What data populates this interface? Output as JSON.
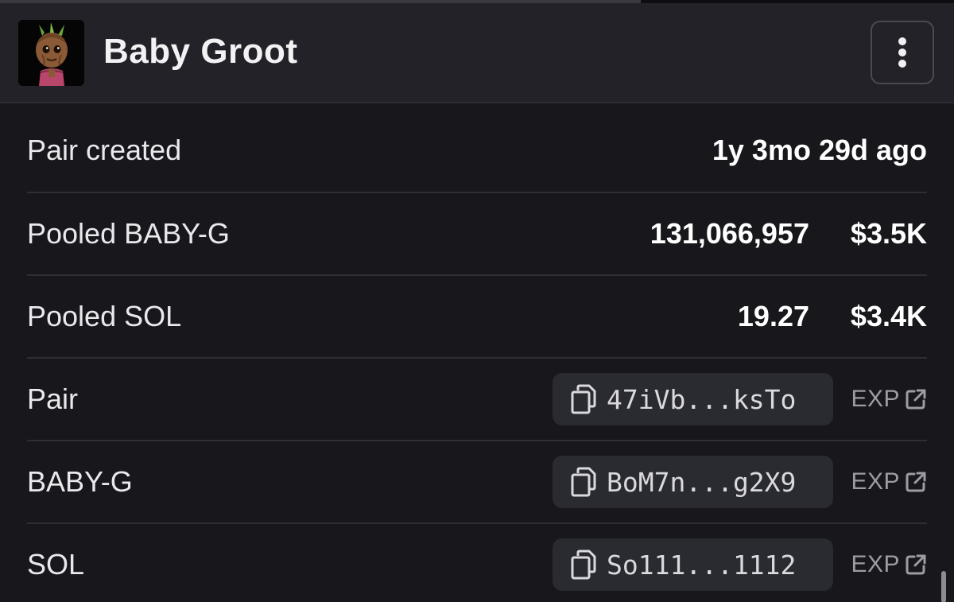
{
  "header": {
    "title": "Baby Groot",
    "avatar_icon": "baby-groot-avatar",
    "menu_icon": "vertical-ellipsis-icon"
  },
  "rows": {
    "pair_created": {
      "label": "Pair created",
      "value": "1y 3mo 29d ago"
    },
    "pooled_token": {
      "label": "Pooled BABY-G",
      "amount": "131,066,957",
      "usd": "$3.5K"
    },
    "pooled_sol": {
      "label": "Pooled SOL",
      "amount": "19.27",
      "usd": "$3.4K"
    },
    "pair": {
      "label": "Pair",
      "address": "47iVb...ksTo",
      "exp": "EXP"
    },
    "token": {
      "label": "BABY-G",
      "address": "BoM7n...g2X9",
      "exp": "EXP"
    },
    "sol": {
      "label": "SOL",
      "address": "So111...1112",
      "exp": "EXP"
    }
  },
  "colors": {
    "background": "#17171c",
    "header": "#222228",
    "address_chip": "#2a2a31",
    "muted_text": "#9c9ca4"
  }
}
